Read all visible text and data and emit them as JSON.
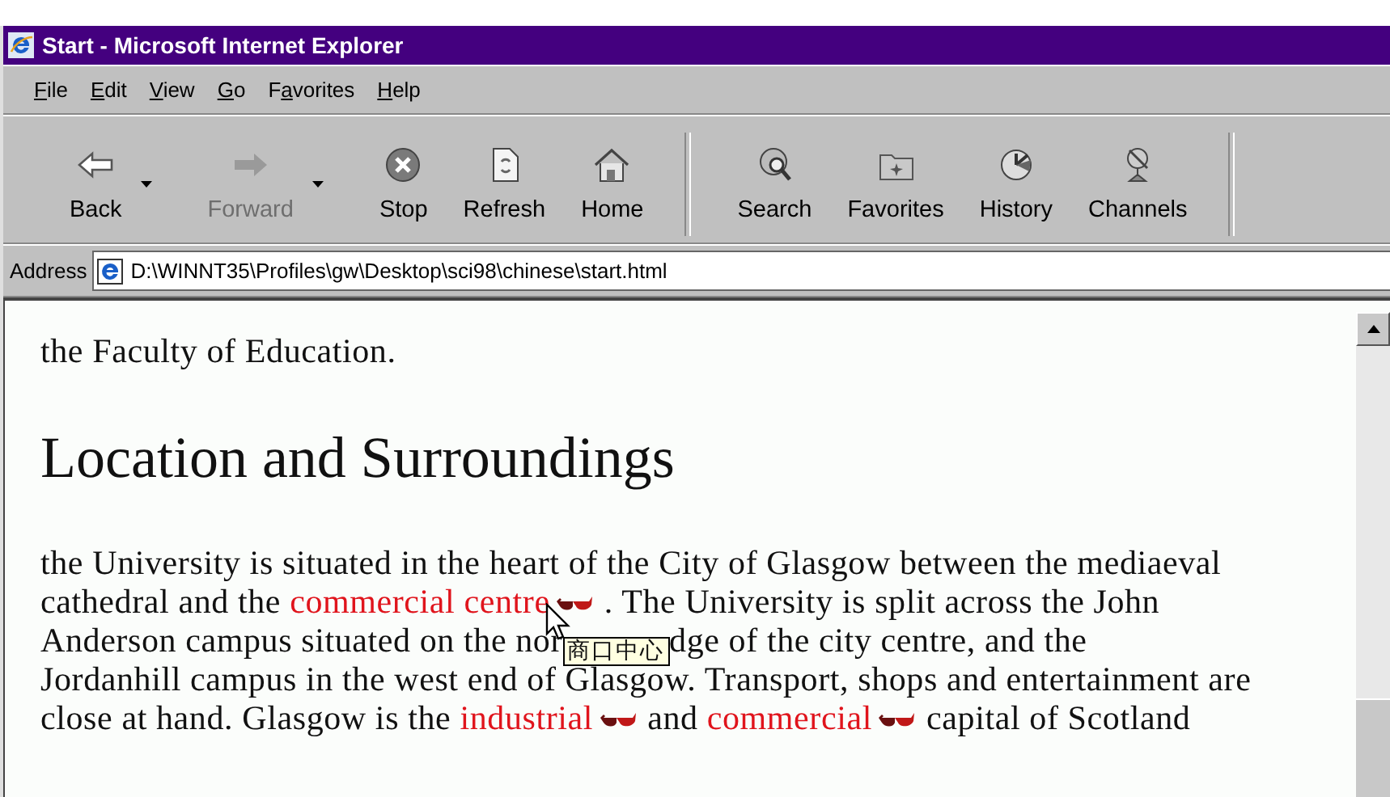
{
  "window": {
    "title": "Start - Microsoft Internet Explorer"
  },
  "menu": [
    {
      "accel": "F",
      "after": "ile"
    },
    {
      "accel": "E",
      "after": "dit"
    },
    {
      "accel": "V",
      "after": "iew"
    },
    {
      "accel": "G",
      "after": "o"
    },
    {
      "before": "F",
      "accel": "a",
      "after": "vorites"
    },
    {
      "accel": "H",
      "after": "elp"
    }
  ],
  "toolbar": [
    {
      "kind": "back",
      "label": "Back",
      "disabled": false,
      "dropdown": true
    },
    {
      "kind": "forward",
      "label": "Forward",
      "disabled": true,
      "dropdown": true
    },
    {
      "kind": "stop",
      "label": "Stop",
      "disabled": false
    },
    {
      "kind": "refresh",
      "label": "Refresh",
      "disabled": false
    },
    {
      "kind": "home",
      "label": "Home",
      "disabled": false
    },
    {
      "kind": "separator"
    },
    {
      "kind": "search",
      "label": "Search",
      "disabled": false
    },
    {
      "kind": "favorites",
      "label": "Favorites",
      "disabled": false
    },
    {
      "kind": "history",
      "label": "History",
      "disabled": false
    },
    {
      "kind": "channels",
      "label": "Channels",
      "disabled": false
    },
    {
      "kind": "separator"
    }
  ],
  "address": {
    "label": "Address",
    "value": "D:\\WINNT35\\Profiles\\gw\\Desktop\\sci98\\chinese\\start.html"
  },
  "page": {
    "intro": "the Faculty of Education.",
    "heading": "Location and Surroundings",
    "paragraph": [
      {
        "kind": "text",
        "text": "the University is situated in the heart of the City of Glasgow between the mediaeval"
      },
      {
        "kind": "break"
      },
      {
        "kind": "text",
        "text": "cathedral and the "
      },
      {
        "kind": "link",
        "text": "commercial centre"
      },
      {
        "kind": "cursor"
      },
      {
        "kind": "glasses"
      },
      {
        "kind": "text",
        "text": " . The University is split across the John"
      },
      {
        "kind": "break"
      },
      {
        "kind": "text",
        "text": "Anderson campus situated on the nor"
      },
      {
        "kind": "tooltip",
        "text": "商口中心"
      },
      {
        "kind": "text",
        "text": "dge of the city centre, and the"
      },
      {
        "kind": "break"
      },
      {
        "kind": "text",
        "text": "Jordanhill campus in the west end of Glasgow. Transport, shops and entertainment are"
      },
      {
        "kind": "break"
      },
      {
        "kind": "text",
        "text": "close at hand. Glasgow is the "
      },
      {
        "kind": "link",
        "text": "industrial"
      },
      {
        "kind": "glasses"
      },
      {
        "kind": "text",
        "text": "  and "
      },
      {
        "kind": "link",
        "text": "commercial"
      },
      {
        "kind": "glasses"
      },
      {
        "kind": "text",
        "text": "  capital of Scotland"
      }
    ]
  }
}
